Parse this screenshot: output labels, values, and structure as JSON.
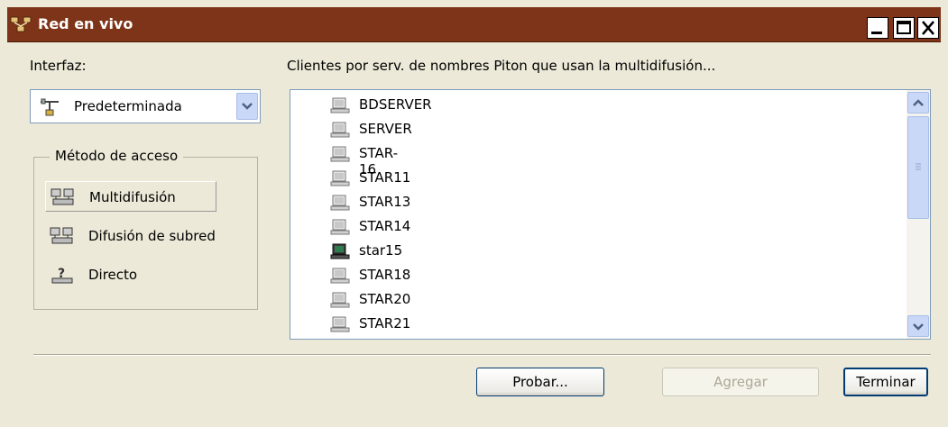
{
  "window": {
    "title": "Red en vivo",
    "icon": "network-app-icon",
    "controls": [
      "minimize-icon",
      "maximize-icon",
      "close-icon"
    ]
  },
  "interface": {
    "label": "Interfaz:",
    "selected": "Predeterminada",
    "icon": "network-adapter-icon"
  },
  "access_method": {
    "legend": "Método de acceso",
    "options": [
      {
        "label": "Multidifusión",
        "icon": "multicast-computers-icon",
        "selected": true
      },
      {
        "label": "Difusión de subred",
        "icon": "subnet-broadcast-icon",
        "selected": false
      },
      {
        "label": "Directo",
        "icon": "direct-question-icon",
        "selected": false
      }
    ]
  },
  "clients": {
    "header": "Clientes por serv. de nombres Piton que usan la multidifusión...",
    "items": [
      {
        "name": "BDSERVER",
        "icon": "server-icon"
      },
      {
        "name": "SERVER",
        "icon": "server-icon"
      },
      {
        "name": "STAR-16",
        "icon": "server-icon"
      },
      {
        "name": "STAR11",
        "icon": "server-icon"
      },
      {
        "name": "STAR13",
        "icon": "server-icon"
      },
      {
        "name": "STAR14",
        "icon": "server-icon"
      },
      {
        "name": "star15",
        "icon": "computer-icon"
      },
      {
        "name": "STAR18",
        "icon": "server-icon"
      },
      {
        "name": "STAR20",
        "icon": "server-icon"
      },
      {
        "name": "STAR21",
        "icon": "server-icon"
      }
    ]
  },
  "buttons": {
    "test": "Probar...",
    "add": "Agregar",
    "finish": "Terminar"
  },
  "colors": {
    "titlebar": "#7e3418",
    "dialog_bg": "#ece9d8",
    "scroll_blue": "#c9d8f6"
  }
}
